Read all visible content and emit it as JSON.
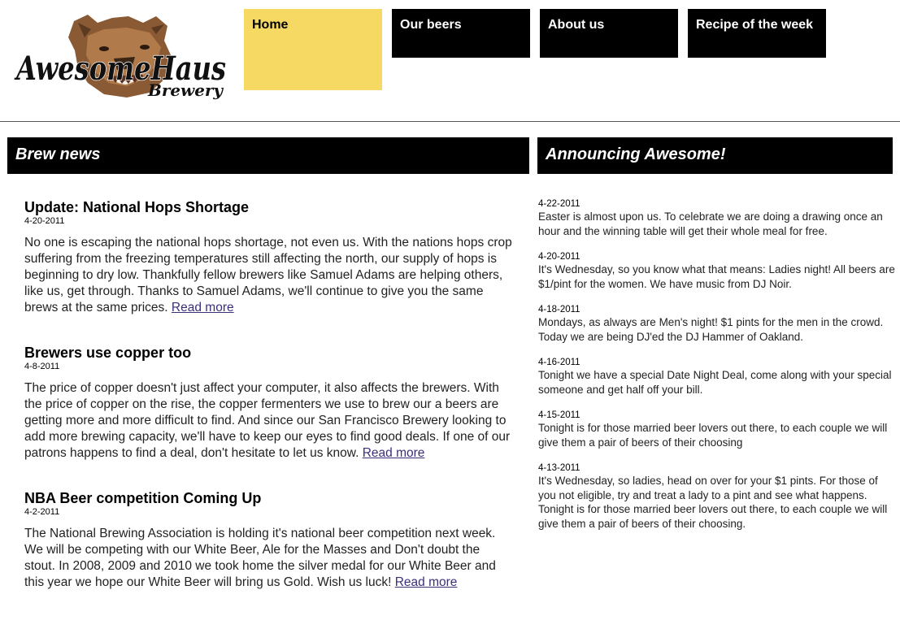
{
  "logo": {
    "brand_line1": "AwesomeHaus",
    "brand_line2": "Brewery"
  },
  "nav": [
    {
      "label": "Home",
      "active": true
    },
    {
      "label": "Our beers",
      "active": false
    },
    {
      "label": "About us",
      "active": false
    },
    {
      "label": "Recipe of the week",
      "active": false
    }
  ],
  "colors": {
    "accent": "#f5d962",
    "header_bg": "#000000",
    "link": "#3b2f7a"
  },
  "news": {
    "title": "Brew news",
    "articles": [
      {
        "title": "Update: National Hops Shortage",
        "date": "4-20-2011",
        "body": "No one is escaping the national hops shortage, not even us. With the nations hops crop suffering from the freezing temperatures still affecting the north, our supply of hops is beginning to dry low. Thankfully fellow brewers like Samuel Adams are helping others, like us, get through. Thanks to Samuel Adams, we'll continue to give you the same brews at the same prices. ",
        "link": "Read more"
      },
      {
        "title": "Brewers use copper too",
        "date": "4-8-2011",
        "body": "The price of copper doesn't just affect your computer, it also affects the brewers. With the price of copper on the rise, the copper fermenters we use to brew our a beers are getting more and more difficult to find. And since our San Francisco Brewery looking to add more brewing capacity, we'll have to keep our eyes to find good deals. If one of our patrons happens to find a deal, don't hesitate to let us know. ",
        "link": "Read more"
      },
      {
        "title": "NBA Beer competition Coming Up",
        "date": "4-2-2011",
        "body": "The National Brewing Association is holding it's national beer competition next week. We will be competing with our White Beer, Ale for the Masses and Don't doubt the stout. In 2008, 2009 and 2010 we took home the silver medal for our White Beer and this year we hope our White Beer will bring us Gold. Wish us luck! ",
        "link": "Read more"
      }
    ]
  },
  "announcements": {
    "title": "Announcing Awesome!",
    "items": [
      {
        "date": "4-22-2011",
        "text": "Easter is almost upon us. To celebrate we are doing a drawing once an hour and the winning table will get their whole meal for free."
      },
      {
        "date": "4-20-2011",
        "text": "It's Wednesday, so you know what that means: Ladies night! All beers are $1/pint for the women. We have music from DJ Noir."
      },
      {
        "date": "4-18-2011",
        "text": "Mondays, as always are Men's night! $1 pints for the men in the crowd. Today we are being DJ'ed the DJ Hammer of Oakland."
      },
      {
        "date": "4-16-2011",
        "text": "Tonight we have a special Date Night Deal, come along with your special someone and get half off your bill."
      },
      {
        "date": "4-15-2011",
        "text": "Tonight is for those married beer lovers out there, to each couple we will give them a pair of beers of their choosing"
      },
      {
        "date": "4-13-2011",
        "text": "It's Wednesday, so ladies, head on over for your $1 pints. For those of you not eligible, try and treat a lady to a pint and see what happens. Tonight is for those married beer lovers out there, to each couple we will give them a pair of beers of their choosing."
      }
    ]
  }
}
